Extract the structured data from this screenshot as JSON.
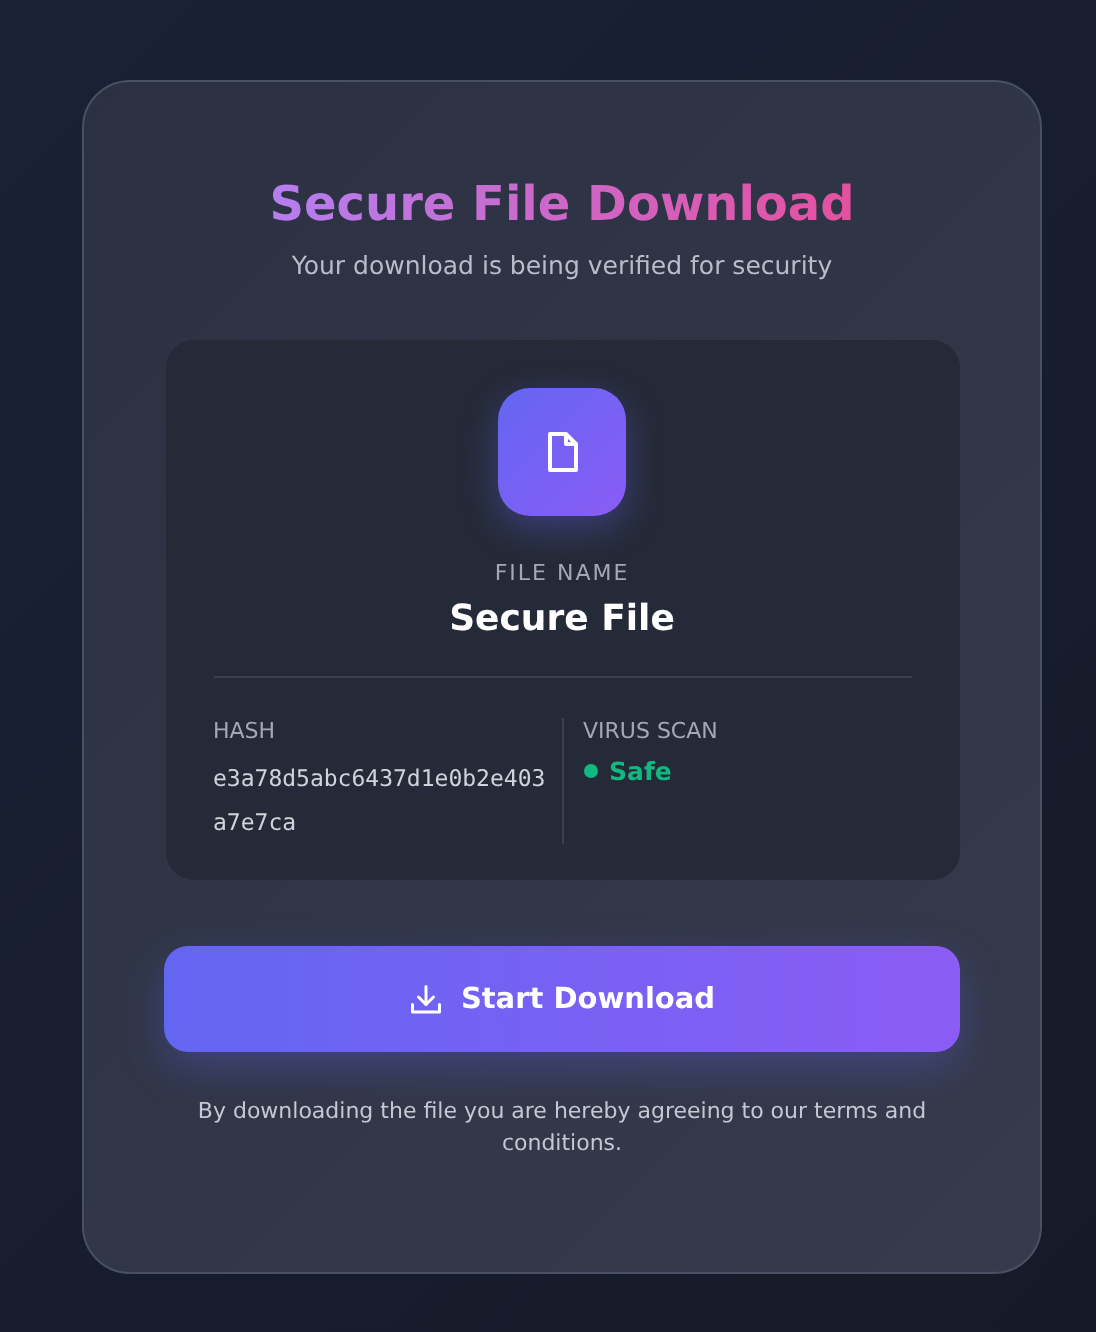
{
  "title": "Secure File Download",
  "subtitle": "Your download is being verified for security",
  "file": {
    "label": "FILE NAME",
    "name": "Secure File"
  },
  "details": [
    {
      "kind": "hash",
      "label": "HASH",
      "value": "e3a78d5abc6437d1e0b2e403a7e7ca"
    },
    {
      "kind": "status",
      "label": "VIRUS SCAN",
      "value": "Safe",
      "color": "#10b981"
    }
  ],
  "button": {
    "label": "Start Download"
  },
  "disclaimer": "By downloading the file you are hereby agreeing to our terms and conditions."
}
